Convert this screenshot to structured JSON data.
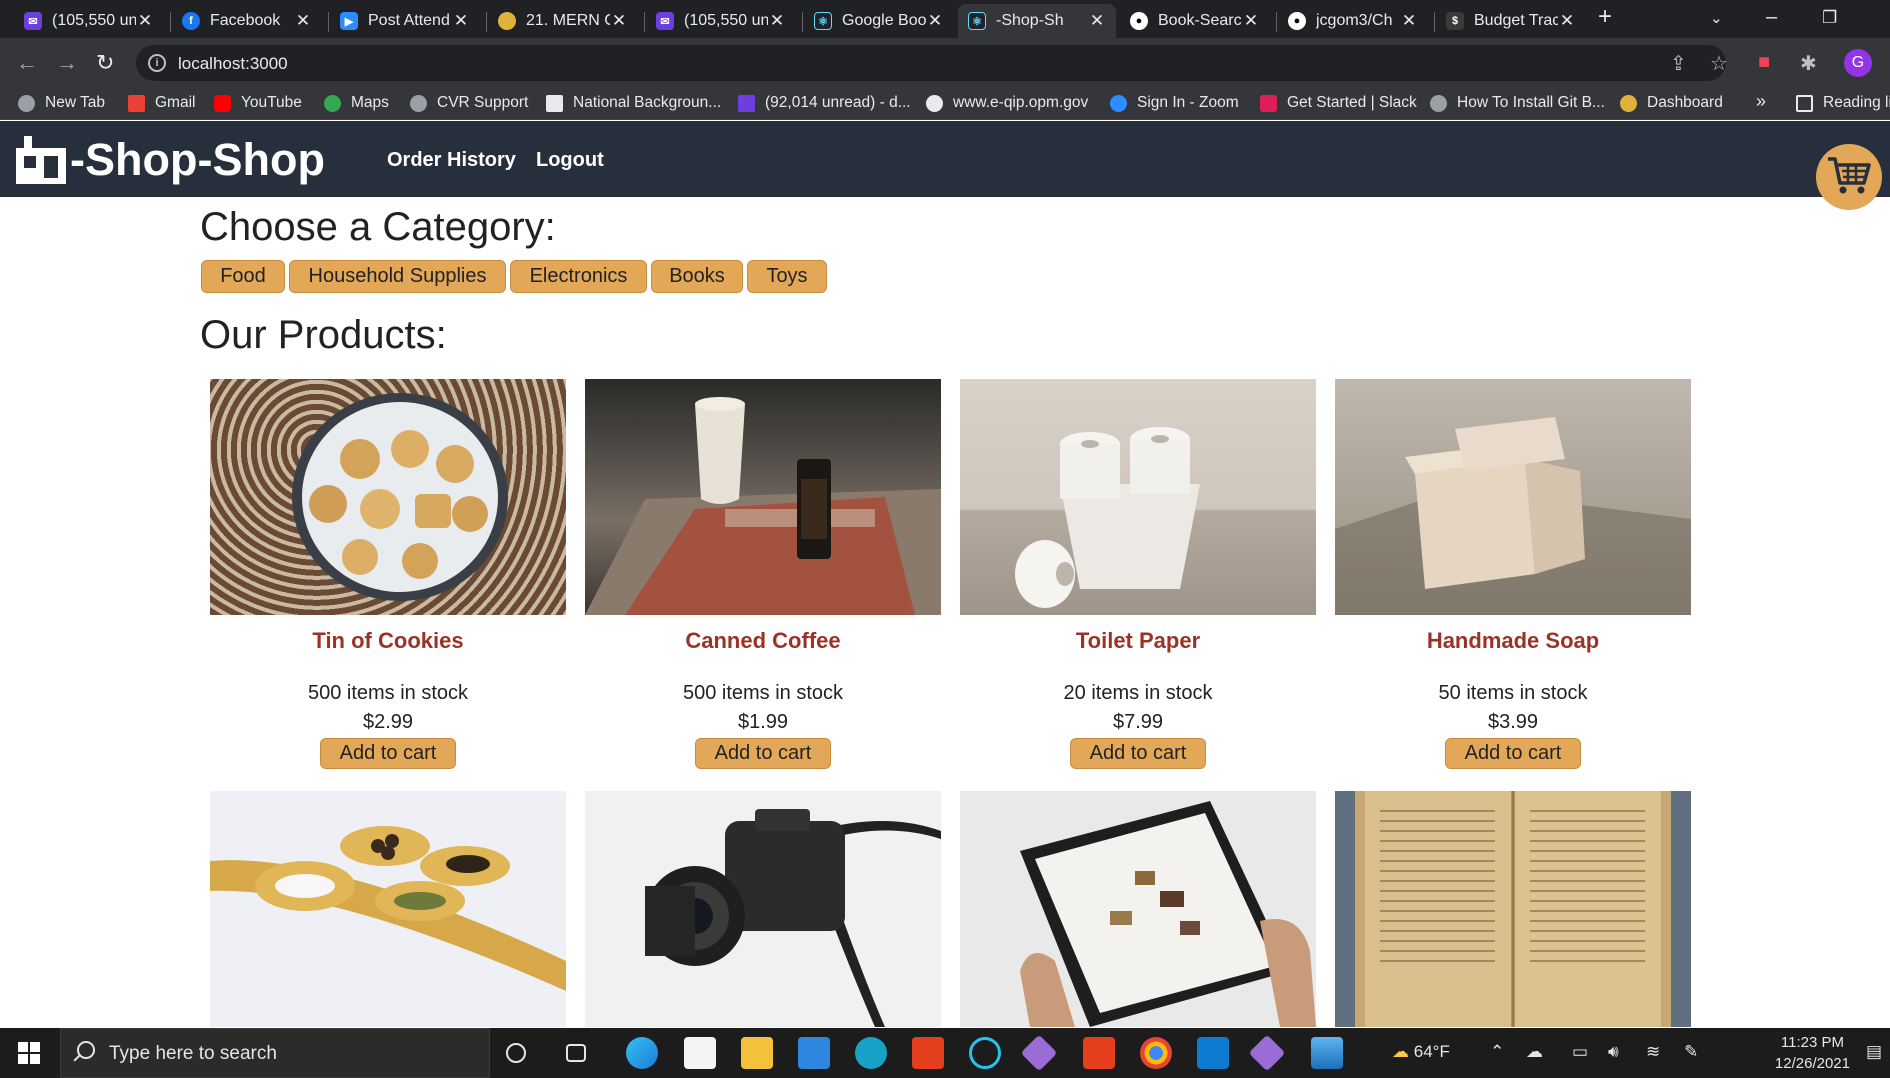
{
  "browser": {
    "tabs": [
      {
        "title": "(105,550 un",
        "icon": "mail-icon",
        "color": "#6d3fe0"
      },
      {
        "title": "Facebook",
        "icon": "facebook-icon",
        "color": "#1877f2"
      },
      {
        "title": "Post Attend",
        "icon": "zoom-icon",
        "color": "#2d8cff"
      },
      {
        "title": "21. MERN C",
        "icon": "course-icon",
        "color": "#e0b23a"
      },
      {
        "title": "(105,550 un",
        "icon": "mail-icon",
        "color": "#6d3fe0"
      },
      {
        "title": "Google Boo",
        "icon": "react-icon",
        "color": "#61dafb"
      },
      {
        "title": "-Shop-Sh",
        "icon": "react-icon",
        "color": "#61dafb"
      },
      {
        "title": "Book-Searc",
        "icon": "github-icon",
        "color": "#ffffff"
      },
      {
        "title": "jcgom3/Ch",
        "icon": "github-icon",
        "color": "#ffffff"
      },
      {
        "title": "Budget Trac",
        "icon": "money-bag-icon",
        "color": "#1c1c1c"
      }
    ],
    "url": "localhost:3000",
    "profile_initial": "G",
    "bookmarks": [
      {
        "label": "New Tab",
        "icon": "globe-icon",
        "color": "#9aa0a6"
      },
      {
        "label": "Gmail",
        "icon": "gmail-icon",
        "color": "#ea4335"
      },
      {
        "label": "YouTube",
        "icon": "youtube-icon",
        "color": "#ff0000"
      },
      {
        "label": "Maps",
        "icon": "maps-icon",
        "color": "#34a853"
      },
      {
        "label": "CVR Support",
        "icon": "globe-icon",
        "color": "#9aa0a6"
      },
      {
        "label": "National Backgroun...",
        "icon": "building-icon",
        "color": "#e8eaed"
      },
      {
        "label": "(92,014 unread) - d...",
        "icon": "mail-icon",
        "color": "#6d3fe0"
      },
      {
        "label": "www.e-qip.opm.gov",
        "icon": "eagle-icon",
        "color": "#e8eaed"
      },
      {
        "label": "Sign In - Zoom",
        "icon": "zoom-icon",
        "color": "#2d8cff"
      },
      {
        "label": "Get Started | Slack",
        "icon": "slack-icon",
        "color": "#e01e5a"
      },
      {
        "label": "How To Install Git B...",
        "icon": "globe-icon",
        "color": "#9aa0a6"
      },
      {
        "label": "Dashboard",
        "icon": "coin-icon",
        "color": "#e0b23a"
      }
    ],
    "more_bookmarks": "»",
    "reading_list": "Reading li"
  },
  "app": {
    "brand": "-Shop-Shop",
    "nav": {
      "order_history": "Order History",
      "logout": "Logout"
    },
    "category_heading": "Choose a Category:",
    "categories": [
      "Food",
      "Household Supplies",
      "Electronics",
      "Books",
      "Toys"
    ],
    "products_heading": "Our Products:",
    "add_label": "Add to cart",
    "accent": "#e3a857",
    "products": [
      {
        "name": "Tin of Cookies",
        "stock": "500 items in stock",
        "price": "$2.99"
      },
      {
        "name": "Canned Coffee",
        "stock": "500 items in stock",
        "price": "$1.99"
      },
      {
        "name": "Toilet Paper",
        "stock": "20 items in stock",
        "price": "$7.99"
      },
      {
        "name": "Handmade Soap",
        "stock": "50 items in stock",
        "price": "$3.99"
      }
    ]
  },
  "taskbar": {
    "search_placeholder": "Type here to search",
    "weather": "64°F",
    "time": "11:23 PM",
    "date": "12/26/2021"
  }
}
